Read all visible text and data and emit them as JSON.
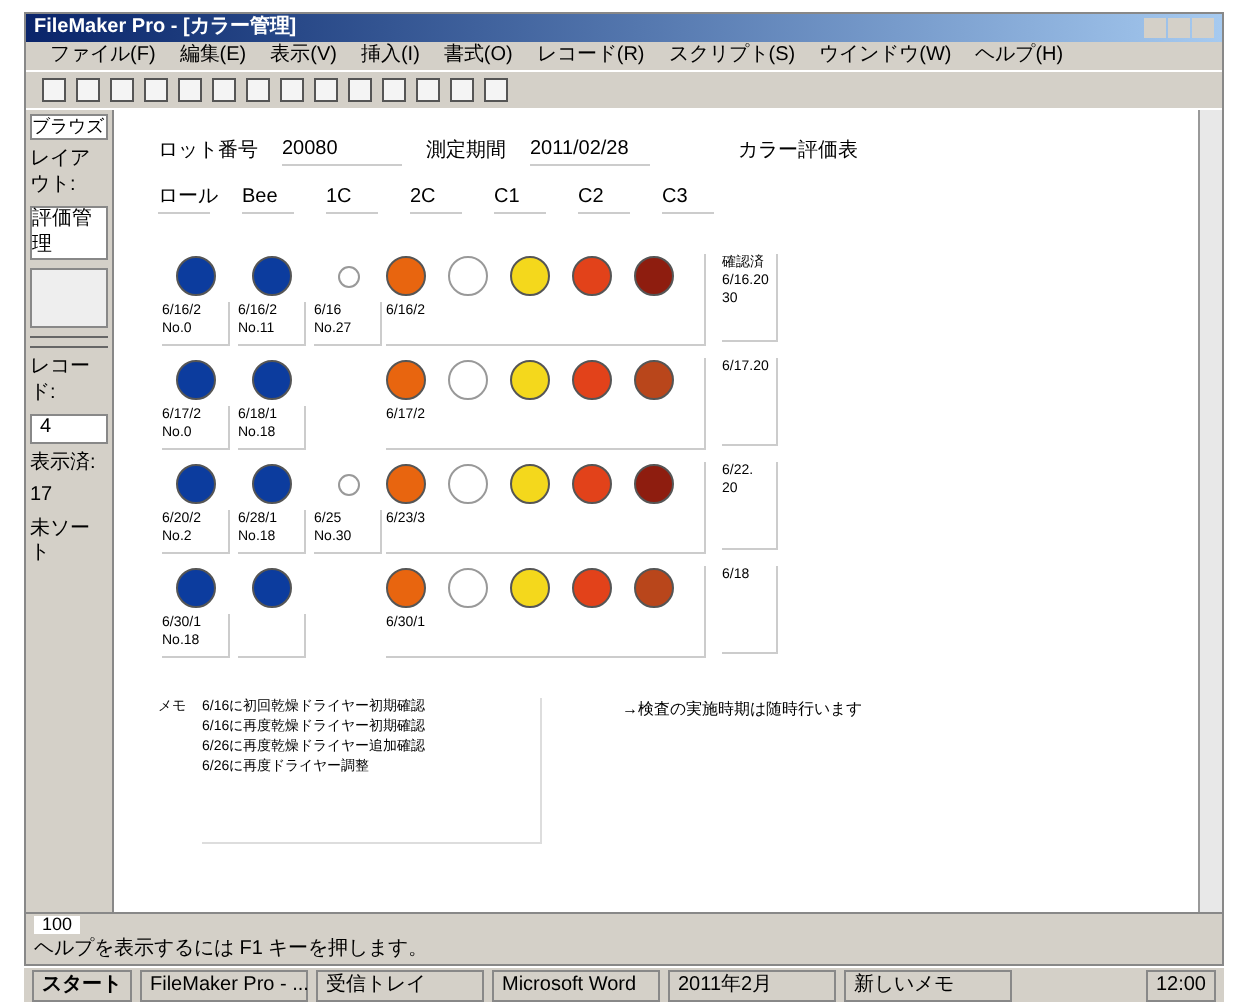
{
  "window": {
    "title": "FileMaker Pro - [カラー管理]"
  },
  "menu": [
    "ファイル(F)",
    "編集(E)",
    "表示(V)",
    "挿入(I)",
    "書式(O)",
    "レコード(R)",
    "スクリプト(S)",
    "ウインドウ(W)",
    "ヘルプ(H)"
  ],
  "sidebar": {
    "mode": "ブラウズ",
    "layout_label": "レイアウト:",
    "layout": "評価管理",
    "record_label": "レコード:",
    "record": "4",
    "found_label": "表示済:",
    "found": "17",
    "sort": "未ソート"
  },
  "header": {
    "fields": [
      {
        "label": "ロット番号",
        "value": "20080"
      },
      {
        "label": "測定期間",
        "value": "2011/02/28"
      }
    ],
    "title": "カラー評価表"
  },
  "columns": [
    "ロール",
    "Bee",
    "1C",
    "2C",
    "C1",
    "C2",
    "C3"
  ],
  "rows": [
    {
      "left": [
        {
          "kind": "filled",
          "color": "#0c3c9e",
          "label": "6/16/2\nNo.0"
        },
        {
          "kind": "filled",
          "color": "#0c3c9e",
          "label": "6/16/2\nNo.11"
        },
        {
          "kind": "small",
          "color": "#ffffff",
          "label": "6/16\nNo.27"
        }
      ],
      "right": [
        {
          "color": "#e8650f"
        },
        {
          "color": "#ffffff"
        },
        {
          "color": "#f4d81c"
        },
        {
          "color": "#e2421a"
        },
        {
          "color": "#8e1d0f"
        }
      ],
      "date": "6/16/2",
      "note": "確認済\n6/16.20\n30"
    },
    {
      "left": [
        {
          "kind": "filled",
          "color": "#0c3c9e",
          "label": "6/17/2\nNo.0"
        },
        {
          "kind": "filled",
          "color": "#0c3c9e",
          "label": "6/18/1\nNo.18"
        }
      ],
      "right": [
        {
          "color": "#e8650f"
        },
        {
          "color": "#ffffff"
        },
        {
          "color": "#f4d81c"
        },
        {
          "color": "#e2421a"
        },
        {
          "color": "#b9461b"
        }
      ],
      "date": "6/17/2",
      "note": "6/17.20"
    },
    {
      "left": [
        {
          "kind": "filled",
          "color": "#0c3c9e",
          "label": "6/20/2\nNo.2"
        },
        {
          "kind": "filled",
          "color": "#0c3c9e",
          "label": "6/28/1\nNo.18"
        },
        {
          "kind": "small",
          "color": "#ffffff",
          "label": "6/25\nNo.30"
        }
      ],
      "right": [
        {
          "color": "#e8650f"
        },
        {
          "color": "#ffffff"
        },
        {
          "color": "#f4d81c"
        },
        {
          "color": "#e2421a"
        },
        {
          "color": "#8e1d0f"
        }
      ],
      "date": "6/23/3",
      "note": "6/22.\n20"
    },
    {
      "left": [
        {
          "kind": "filled",
          "color": "#0c3c9e",
          "label": "6/30/1\nNo.18"
        },
        {
          "kind": "filled",
          "color": "#0c3c9e"
        }
      ],
      "right": [
        {
          "color": "#e8650f"
        },
        {
          "color": "#ffffff"
        },
        {
          "color": "#f4d81c"
        },
        {
          "color": "#e2421a"
        },
        {
          "color": "#b9461b"
        }
      ],
      "date": "6/30/1",
      "note": "6/18"
    }
  ],
  "memo": {
    "label": "メモ",
    "lines": [
      "6/16に初回乾燥ドライヤー初期確認",
      "6/16に再度乾燥ドライヤー初期確認",
      "6/26に再度乾燥ドライヤー追加確認",
      "6/26に再度ドライヤー調整"
    ],
    "remark": "→検査の実施時期は随時行います"
  },
  "status": {
    "zoom": "100",
    "help": "ヘルプを表示するには F1 キーを押します。"
  },
  "taskbar": {
    "start": "スタート",
    "items": [
      "FileMaker Pro - ...",
      "受信トレイ",
      "Microsoft Word",
      "2011年2月",
      "新しいメモ"
    ],
    "clock": "12:00"
  }
}
